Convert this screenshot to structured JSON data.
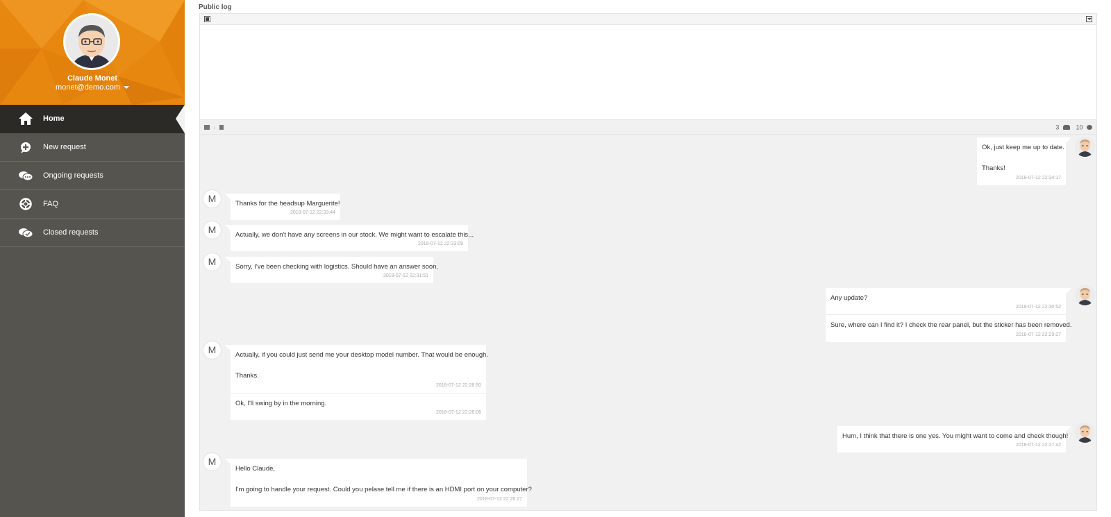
{
  "user": {
    "name": "Claude Monet",
    "email": "monet@demo.com"
  },
  "menu": [
    {
      "label": "Home",
      "icon": "home-icon",
      "active": true
    },
    {
      "label": "New request",
      "icon": "plus-circle-icon"
    },
    {
      "label": "Ongoing requests",
      "icon": "chat-bubbles-icon"
    },
    {
      "label": "FAQ",
      "icon": "lifebuoy-icon"
    },
    {
      "label": "Closed requests",
      "icon": "closed-chat-icon"
    }
  ],
  "log": {
    "title": "Public log",
    "participants": "3",
    "messages": "10"
  },
  "feed": {
    "agent_initial": "M",
    "m1": {
      "text": "Ok, just keep me up to date.",
      "text2": "Thanks!",
      "time": "2018-07-12 22:34:17"
    },
    "m2": {
      "text": "Thanks for the headsup Marguerite!",
      "time": "2018-07-12 22:33:44"
    },
    "m3": {
      "text": "Actually, we don't have any screens in our stock. We might want to escalate this...",
      "time": "2018-07-12 22:33:09"
    },
    "m4": {
      "text": "Sorry, I've been checking with logistics. Should have an answer soon.",
      "time": "2018-07-12 22:31:51"
    },
    "m5": {
      "text": "Any update?",
      "time": "2018-07-12 22:30:52"
    },
    "m6": {
      "text": "Sure, where can I find it? I check the rear panel, but the sticker has been removed.",
      "time": "2018-07-12 22:29:27"
    },
    "m7": {
      "text": "Actually, if you could just send me your desktop model number. That would be enough.",
      "text2": "Thanks.",
      "time": "2018-07-12 22:28:50"
    },
    "m8": {
      "text": "Ok, I'll swing by in the morning.",
      "time": "2018-07-12 22:28:06"
    },
    "m9": {
      "text": "Hum, I think that there is one yes. You might want to come and check though!",
      "time": "2018-07-12 22:27:42"
    },
    "m10": {
      "text": "Hello Claude,",
      "text2": "I'm going to handle your request. Could you pelase tell me if there is an HDMI port on your computer?",
      "time": "2018-07-12 22:26:27"
    }
  },
  "colors": {
    "profile_orange": "#e8870f",
    "sidebar_bg": "#55544f",
    "active_item_bg": "#2b2a27",
    "feed_bg": "#f1f1f1"
  }
}
